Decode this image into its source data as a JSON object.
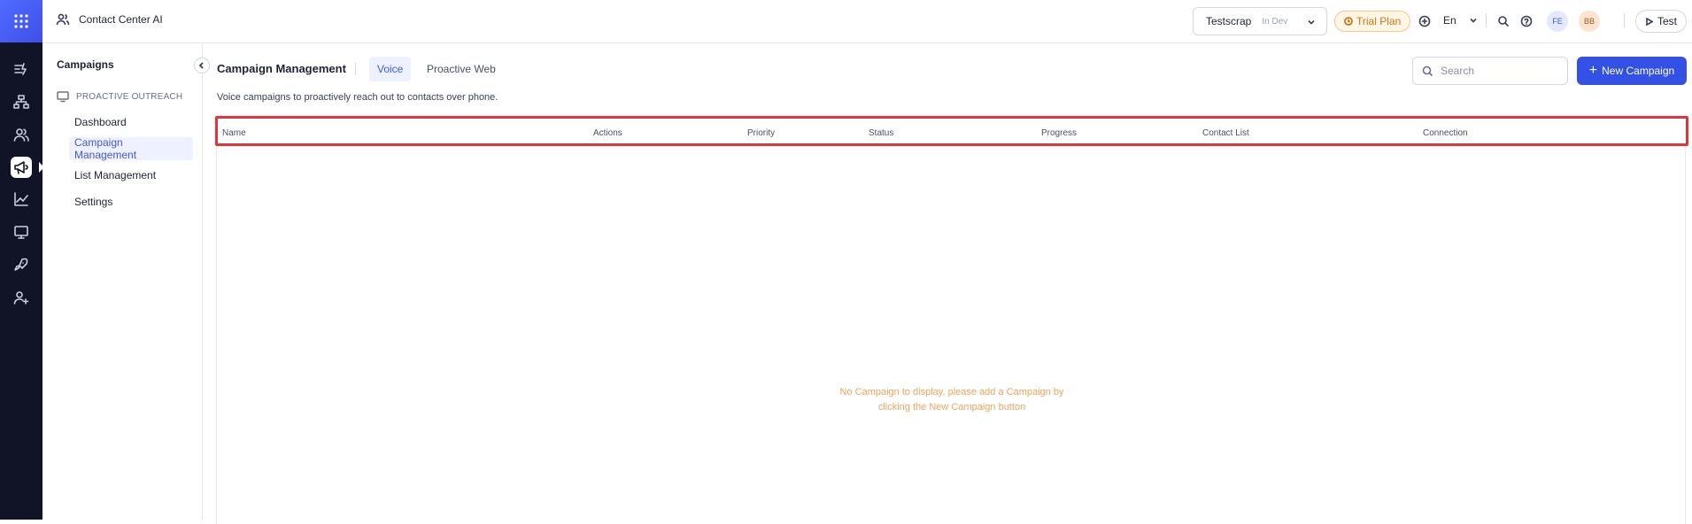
{
  "topbar": {
    "app_title": "Contact Center AI",
    "workspace": {
      "name": "Testscrap",
      "env": "In Dev"
    },
    "trial_label": "Trial Plan",
    "language": "En",
    "avatars": [
      "FE",
      "BB"
    ],
    "test_label": "Test"
  },
  "rail": {
    "icons": [
      "apps-grid-icon",
      "flows-icon",
      "hierarchy-icon",
      "users-icon",
      "megaphone-icon",
      "analytics-icon",
      "monitor-icon",
      "rocket-icon",
      "add-user-icon"
    ],
    "active": "megaphone-icon"
  },
  "sidebar": {
    "title": "Campaigns",
    "section": "PROACTIVE OUTREACH",
    "items": [
      {
        "label": "Dashboard"
      },
      {
        "label": "Campaign Management",
        "active": true
      },
      {
        "label": "List Management"
      },
      {
        "label": "Settings"
      }
    ]
  },
  "main": {
    "title": "Campaign Management",
    "tabs": [
      {
        "label": "Voice",
        "active": true
      },
      {
        "label": "Proactive Web"
      }
    ],
    "subtitle": "Voice campaigns to proactively reach out to contacts over phone.",
    "search_placeholder": "Search",
    "new_button": "New Campaign",
    "table": {
      "columns": [
        "Name",
        "Actions",
        "Priority",
        "Status",
        "Progress",
        "Contact List",
        "Connection"
      ],
      "empty_line1": "No Campaign to display, please add a Campaign by",
      "empty_line2": "clicking the New Campaign button"
    }
  },
  "colors": {
    "accent": "#3451e6",
    "rail_bg": "#101426",
    "highlight_border": "#e0353c",
    "empty_text": "#f0a45a",
    "trial": "#c8771a"
  }
}
